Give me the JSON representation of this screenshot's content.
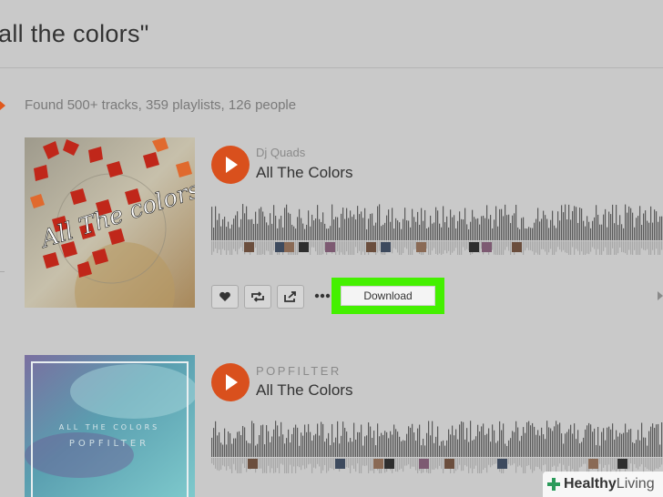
{
  "search": {
    "query_heading": "all the colors\""
  },
  "results": {
    "summary": "Found 500+ tracks, 359 playlists, 126 people"
  },
  "tracks": [
    {
      "artist": "Dj Quads",
      "title": "All The Colors",
      "art_text": "All The colors"
    },
    {
      "artist": "POPFILTER",
      "title": "All The Colors",
      "art_text": "ALL THE COLORS",
      "art_subtext": "POPFILTER"
    }
  ],
  "actions": {
    "like_icon": "heart-icon",
    "repost_icon": "repost-icon",
    "share_icon": "share-icon",
    "more_icon": "more-icon",
    "download_label": "Download"
  },
  "colors": {
    "accent": "#d9501d",
    "highlight": "#44f000",
    "background": "#c9c9c9"
  },
  "watermark": {
    "brand": "Healthy",
    "brand_light": "Living"
  }
}
